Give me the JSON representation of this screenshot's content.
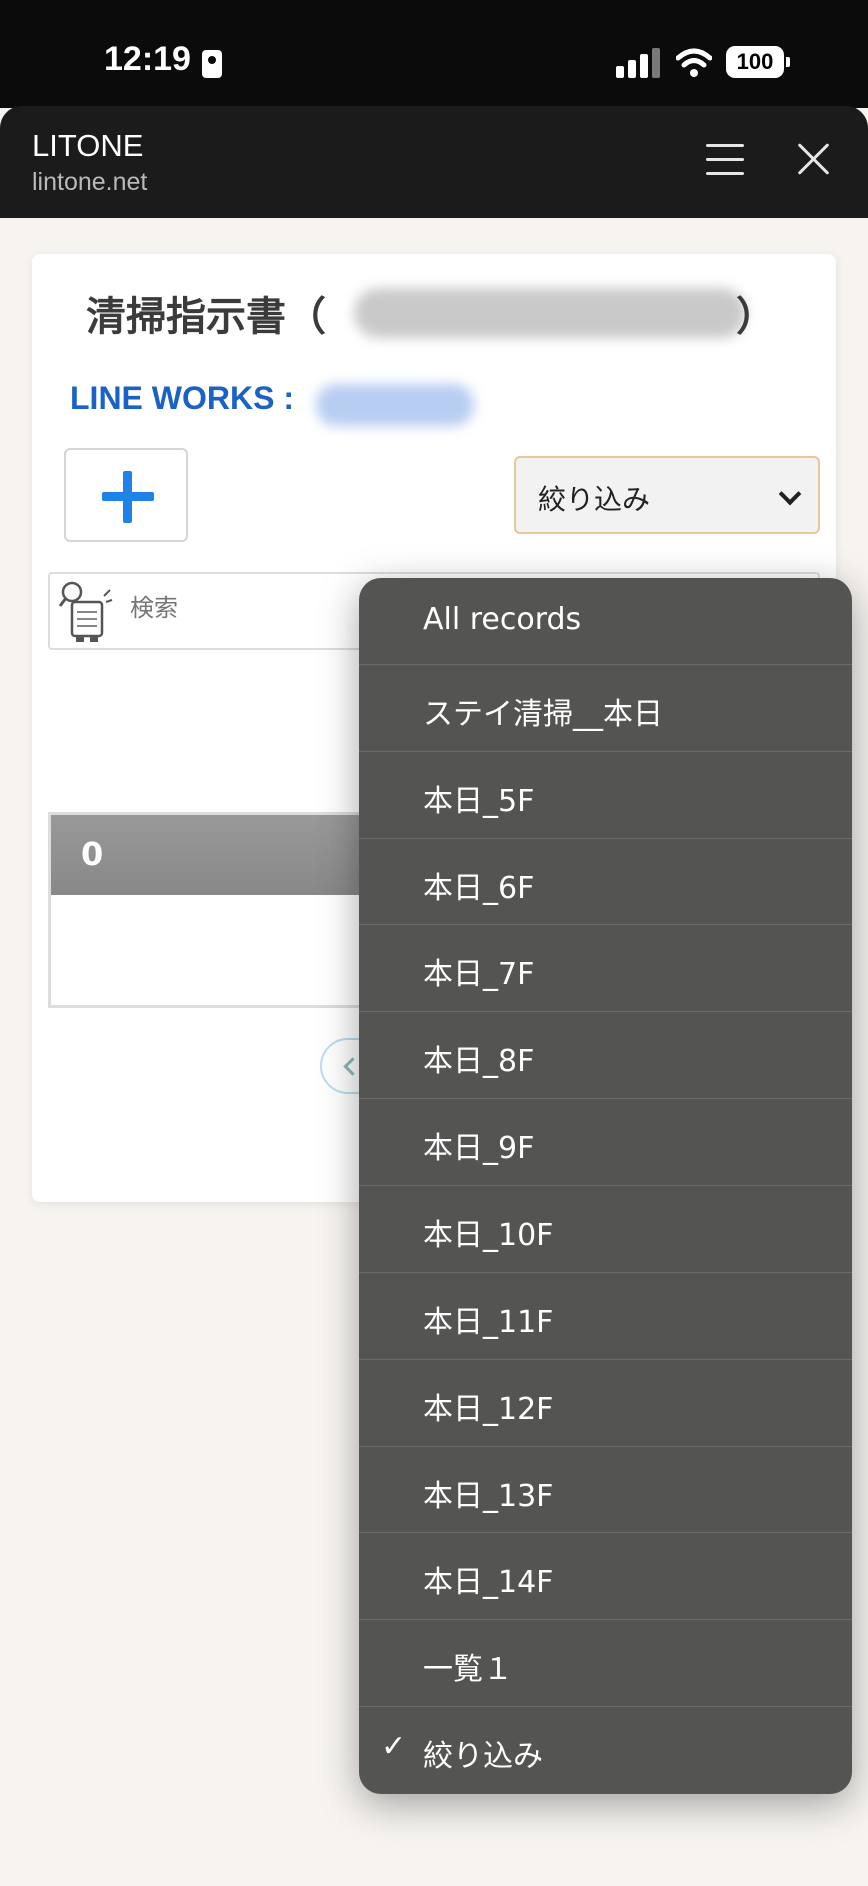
{
  "status_bar": {
    "time": "12:19",
    "battery": "100"
  },
  "browser": {
    "title": "LITONE",
    "url": "lintone.net"
  },
  "page": {
    "title": "清掃指示書（",
    "title_close": "）",
    "line_works_label": "LINE WORKS :",
    "filter_selected": "絞り込み",
    "search_placeholder": "検索",
    "table_header": "0"
  },
  "dropdown": {
    "items": [
      {
        "label": "All records",
        "checked": false
      },
      {
        "label": "ステイ清掃__本日",
        "checked": false
      },
      {
        "label": "本日_5F",
        "checked": false
      },
      {
        "label": "本日_6F",
        "checked": false
      },
      {
        "label": "本日_7F",
        "checked": false
      },
      {
        "label": "本日_8F",
        "checked": false
      },
      {
        "label": "本日_9F",
        "checked": false
      },
      {
        "label": "本日_10F",
        "checked": false
      },
      {
        "label": "本日_11F",
        "checked": false
      },
      {
        "label": "本日_12F",
        "checked": false
      },
      {
        "label": "本日_13F",
        "checked": false
      },
      {
        "label": "本日_14F",
        "checked": false
      },
      {
        "label": "一覧１",
        "checked": false
      },
      {
        "label": "絞り込み",
        "checked": true
      }
    ],
    "check_glyph": "✓"
  }
}
